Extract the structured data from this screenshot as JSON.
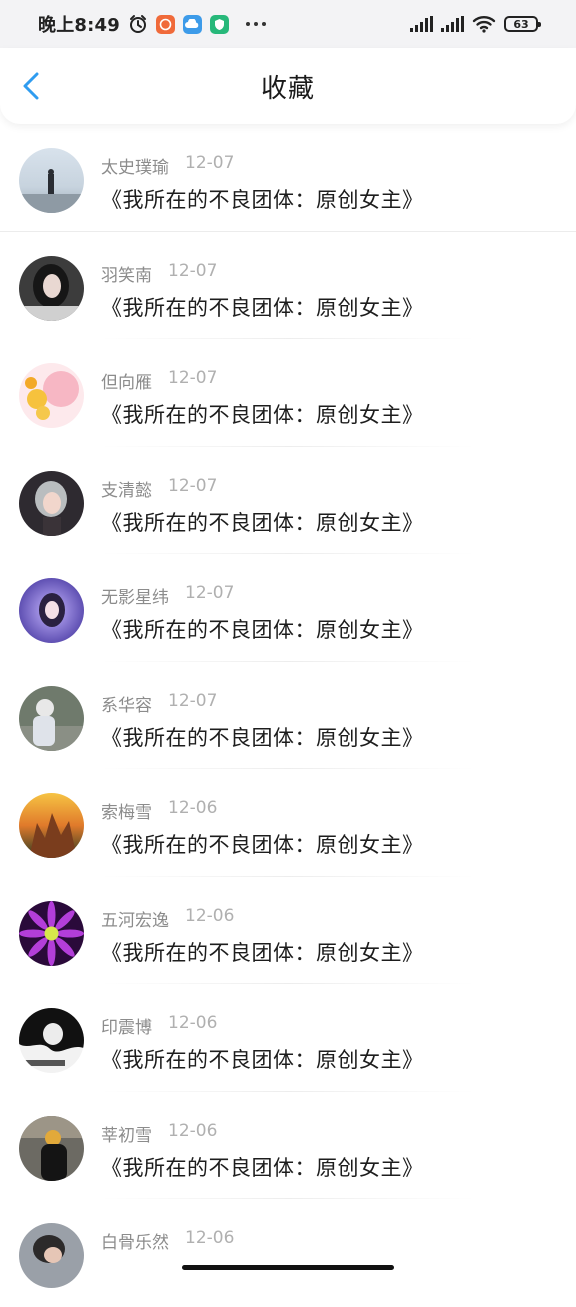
{
  "status_bar": {
    "time": "晚上8:49",
    "battery": "63"
  },
  "nav": {
    "title": "收藏"
  },
  "favorites": [
    {
      "name": "太史璞瑜",
      "date": "12-07",
      "title": "《我所在的不良团体：原创女主》"
    },
    {
      "name": "羽笑南",
      "date": "12-07",
      "title": "《我所在的不良团体：原创女主》"
    },
    {
      "name": "但向雁",
      "date": "12-07",
      "title": "《我所在的不良团体：原创女主》"
    },
    {
      "name": "支清懿",
      "date": "12-07",
      "title": "《我所在的不良团体：原创女主》"
    },
    {
      "name": "无影星纬",
      "date": "12-07",
      "title": "《我所在的不良团体：原创女主》"
    },
    {
      "name": "系华容",
      "date": "12-07",
      "title": "《我所在的不良团体：原创女主》"
    },
    {
      "name": "索梅雪",
      "date": "12-06",
      "title": "《我所在的不良团体：原创女主》"
    },
    {
      "name": "五河宏逸",
      "date": "12-06",
      "title": "《我所在的不良团体：原创女主》"
    },
    {
      "name": "印震博",
      "date": "12-06",
      "title": "《我所在的不良团体：原创女主》"
    },
    {
      "name": "莘初雪",
      "date": "12-06",
      "title": "《我所在的不良团体：原创女主》"
    },
    {
      "name": "白骨乐然",
      "date": "12-06",
      "title": ""
    }
  ],
  "colors": {
    "accent_back_arrow": "#2f9cf0"
  }
}
